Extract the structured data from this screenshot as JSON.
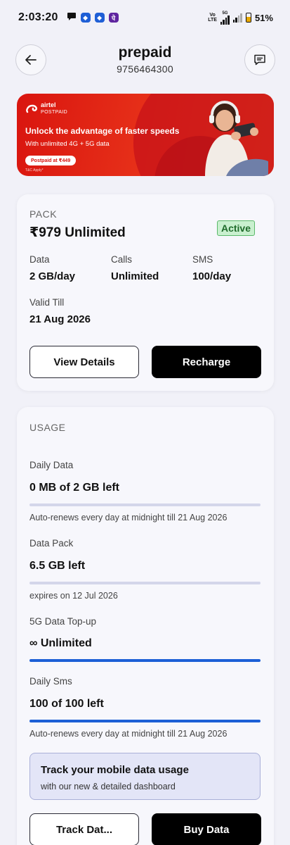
{
  "status_bar": {
    "time": "2:03:20",
    "volte": "Vo LTE",
    "network": "5G",
    "battery": "51%"
  },
  "header": {
    "title": "prepaid",
    "phone": "9756464300"
  },
  "banner": {
    "brand": "airtel",
    "brand_sub": "POSTPAID",
    "headline": "Unlock the advantage of faster speeds",
    "subline": "With unlimited 4G + 5G data",
    "pill": "Postpaid at ₹449",
    "tc": "T&C Apply*"
  },
  "pack": {
    "caption": "PACK",
    "name": "₹979 Unlimited",
    "status": "Active",
    "data_label": "Data",
    "data_value": "2 GB/day",
    "calls_label": "Calls",
    "calls_value": "Unlimited",
    "sms_label": "SMS",
    "sms_value": "100/day",
    "valid_label": "Valid Till",
    "valid_value": "21 Aug 2026",
    "view_details": "View Details",
    "recharge": "Recharge"
  },
  "usage": {
    "caption": "USAGE",
    "items": [
      {
        "title": "Daily Data",
        "value": "0 MB of 2 GB left",
        "fraction_left": 0,
        "note": "Auto-renews every day at midnight till 21 Aug 2026"
      },
      {
        "title": "Data Pack",
        "value": "6.5 GB left",
        "fraction_left": 0,
        "note": "expires on 12 Jul 2026"
      },
      {
        "title": "5G Data Top-up",
        "value": "∞ Unlimited",
        "fraction_left": 1,
        "note": ""
      },
      {
        "title": "Daily Sms",
        "value": "100 of 100 left",
        "fraction_left": 1,
        "note": "Auto-renews every day at midnight till 21 Aug 2026"
      }
    ],
    "promo_title": "Track your mobile data usage",
    "promo_sub": "with our new & detailed dashboard",
    "track_button": "Track Dat...",
    "buy_button": "Buy Data"
  },
  "colors": {
    "accent_blue": "#1c5fd6",
    "airtel_red": "#e8331a",
    "active_green": "#c9f0cf"
  }
}
